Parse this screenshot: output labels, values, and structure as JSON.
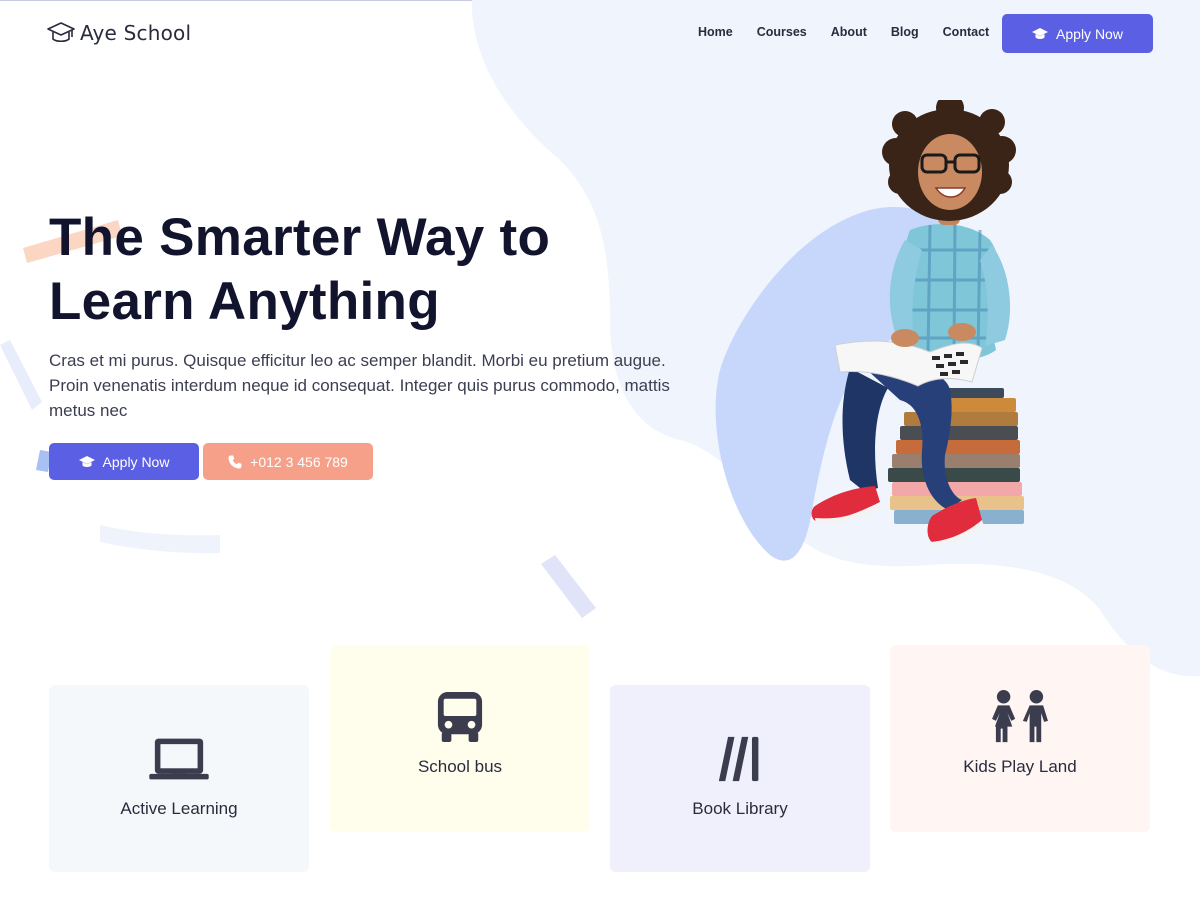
{
  "site": {
    "name": "Aye School",
    "logo_icon": "graduation-cap-icon"
  },
  "nav": {
    "items": [
      {
        "label": "Home"
      },
      {
        "label": "Courses"
      },
      {
        "label": "About"
      },
      {
        "label": "Blog"
      },
      {
        "label": "Contact"
      }
    ],
    "apply_label": "Apply Now",
    "apply_icon": "graduation-cap-icon"
  },
  "hero": {
    "title_line1": "The Smarter Way to",
    "title_line2": "Learn Anything",
    "description": "Cras et mi purus. Quisque efficitur leo ac semper blandit. Morbi eu pretium augue. Proin venenatis interdum neque id consequat. Integer quis purus commodo, mattis metus nec",
    "apply_label": "Apply Now",
    "apply_icon": "graduation-cap-icon",
    "phone_label": "+012 3 456 789",
    "phone_icon": "phone-icon"
  },
  "features": [
    {
      "label": "Active Learning",
      "icon": "laptop-icon"
    },
    {
      "label": "School bus",
      "icon": "bus-icon"
    },
    {
      "label": "Book Library",
      "icon": "books-icon"
    },
    {
      "label": "Kids Play Land",
      "icon": "children-icon"
    }
  ],
  "colors": {
    "primary": "#5b5fe3",
    "salmon": "#f6a08a",
    "heading": "#12142e",
    "blob": "#eff4fd",
    "card_1": "#f5f8fa",
    "card_2": "#fffdeb",
    "card_3": "#f0f0fc",
    "card_4": "#fff5f3"
  }
}
